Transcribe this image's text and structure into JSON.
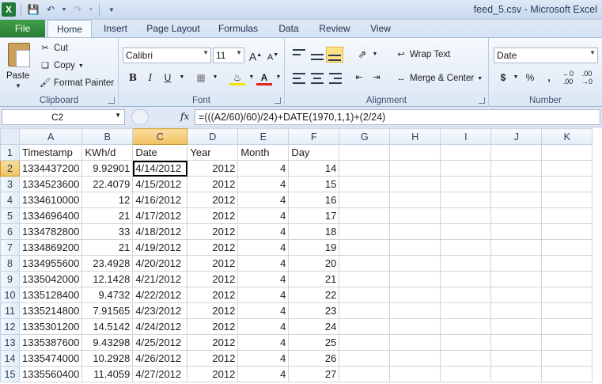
{
  "window": {
    "title": "feed_5.csv - Microsoft Excel",
    "app_icon": "X",
    "qat": {
      "save": "save-icon",
      "undo": "undo-icon",
      "redo": "redo-icon",
      "customize": "customize-icon"
    }
  },
  "tabs": [
    "File",
    "Home",
    "Insert",
    "Page Layout",
    "Formulas",
    "Data",
    "Review",
    "View"
  ],
  "ribbon": {
    "clipboard": {
      "label": "Clipboard",
      "paste": "Paste",
      "cut": "Cut",
      "copy": "Copy",
      "format_painter": "Format Painter"
    },
    "font": {
      "label": "Font",
      "name": "Calibri",
      "size": "11"
    },
    "alignment": {
      "label": "Alignment",
      "wrap_text": "Wrap Text",
      "merge_center": "Merge & Center"
    },
    "number": {
      "label": "Number",
      "format": "Date"
    }
  },
  "formula_bar": {
    "name_box": "C2",
    "fx": "fx",
    "formula": "=(((A2/60)/60)/24)+DATE(1970,1,1)+(2/24)"
  },
  "sheet": {
    "columns": [
      "A",
      "B",
      "C",
      "D",
      "E",
      "F",
      "G",
      "H",
      "I",
      "J",
      "K"
    ],
    "selected_column": "C",
    "active_row": "2",
    "rows": [
      {
        "n": "1",
        "cells": [
          "Timestamp",
          "KWh/d",
          "Date",
          "Year",
          "Month",
          "Day"
        ]
      },
      {
        "n": "2",
        "cells": [
          "1334437200",
          "9.92901",
          "4/14/2012",
          "2012",
          "4",
          "14"
        ]
      },
      {
        "n": "3",
        "cells": [
          "1334523600",
          "22.4079",
          "4/15/2012",
          "2012",
          "4",
          "15"
        ]
      },
      {
        "n": "4",
        "cells": [
          "1334610000",
          "12",
          "4/16/2012",
          "2012",
          "4",
          "16"
        ]
      },
      {
        "n": "5",
        "cells": [
          "1334696400",
          "21",
          "4/17/2012",
          "2012",
          "4",
          "17"
        ]
      },
      {
        "n": "6",
        "cells": [
          "1334782800",
          "33",
          "4/18/2012",
          "2012",
          "4",
          "18"
        ]
      },
      {
        "n": "7",
        "cells": [
          "1334869200",
          "21",
          "4/19/2012",
          "2012",
          "4",
          "19"
        ]
      },
      {
        "n": "8",
        "cells": [
          "1334955600",
          "23.4928",
          "4/20/2012",
          "2012",
          "4",
          "20"
        ]
      },
      {
        "n": "9",
        "cells": [
          "1335042000",
          "12.1428",
          "4/21/2012",
          "2012",
          "4",
          "21"
        ]
      },
      {
        "n": "10",
        "cells": [
          "1335128400",
          "9.4732",
          "4/22/2012",
          "2012",
          "4",
          "22"
        ]
      },
      {
        "n": "11",
        "cells": [
          "1335214800",
          "7.91565",
          "4/23/2012",
          "2012",
          "4",
          "23"
        ]
      },
      {
        "n": "12",
        "cells": [
          "1335301200",
          "14.5142",
          "4/24/2012",
          "2012",
          "4",
          "24"
        ]
      },
      {
        "n": "13",
        "cells": [
          "1335387600",
          "9.43298",
          "4/25/2012",
          "2012",
          "4",
          "25"
        ]
      },
      {
        "n": "14",
        "cells": [
          "1335474000",
          "10.2928",
          "4/26/2012",
          "2012",
          "4",
          "26"
        ]
      },
      {
        "n": "15",
        "cells": [
          "1335560400",
          "11.4059",
          "4/27/2012",
          "2012",
          "4",
          "27"
        ]
      }
    ]
  }
}
